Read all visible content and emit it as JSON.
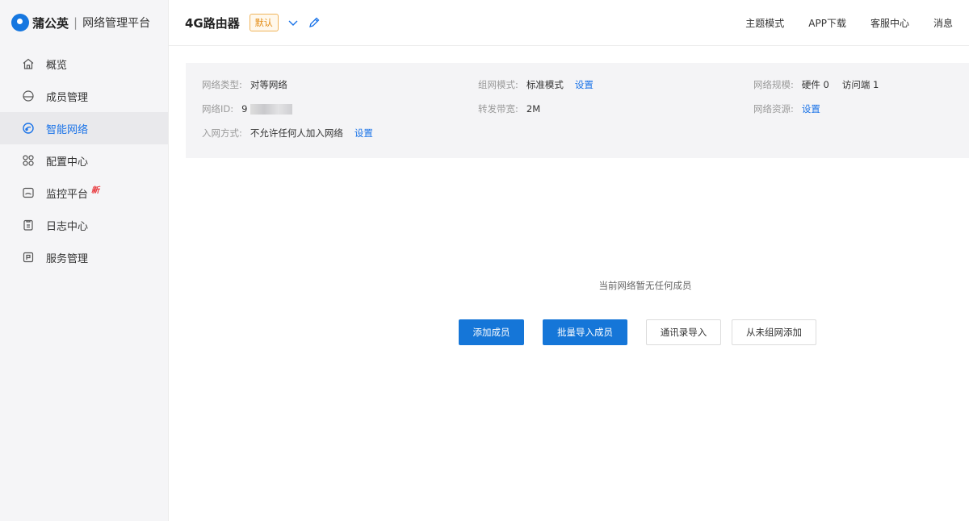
{
  "brand": {
    "name": "蒲公英",
    "separator": "|",
    "subtitle": "网络管理平台"
  },
  "sidebar": {
    "items": [
      {
        "label": "概览",
        "icon": "home-icon"
      },
      {
        "label": "成员管理",
        "icon": "member-icon"
      },
      {
        "label": "智能网络",
        "icon": "network-icon",
        "active": true
      },
      {
        "label": "配置中心",
        "icon": "config-grid-icon"
      },
      {
        "label": "监控平台",
        "icon": "monitor-icon",
        "badge": "新"
      },
      {
        "label": "日志中心",
        "icon": "log-icon"
      },
      {
        "label": "服务管理",
        "icon": "service-icon"
      }
    ]
  },
  "header": {
    "device_title": "4G路由器",
    "default_tag": "默认",
    "links": [
      "主题模式",
      "APP下载",
      "客服中心",
      "消息"
    ]
  },
  "info": {
    "network_type_label": "网络类型:",
    "network_type_value": "对等网络",
    "group_mode_label": "组网模式:",
    "group_mode_value": "标准模式",
    "group_mode_link": "设置",
    "network_size_label": "网络规模:",
    "network_size_hw": "硬件 0",
    "network_size_visitor": "访问端 1",
    "network_id_label": "网络ID:",
    "network_id_value": "9",
    "bandwidth_label": "转发带宽:",
    "bandwidth_value": "2M",
    "network_resource_label": "网络资源:",
    "network_resource_link": "设置",
    "join_mode_label": "入网方式:",
    "join_mode_value": "不允许任何人加入网络",
    "join_mode_link": "设置"
  },
  "empty": {
    "message": "当前网络暂无任何成员",
    "buttons": {
      "add_member": "添加成员",
      "batch_import": "批量导入成员",
      "contacts_import": "通讯录导入",
      "from_unjoined": "从未组网添加"
    }
  },
  "colors": {
    "primary": "#1576d8",
    "active_nav": "#1a73e8",
    "tag_border": "#f0b45a",
    "badge_red": "#e8383d"
  }
}
